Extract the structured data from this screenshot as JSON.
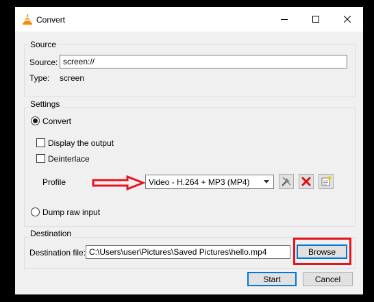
{
  "window": {
    "title": "Convert"
  },
  "source": {
    "group_title": "Source",
    "source_label": "Source:",
    "source_value": "screen://",
    "type_label": "Type:",
    "type_value": "screen"
  },
  "settings": {
    "group_title": "Settings",
    "convert_label": "Convert",
    "display_output_label": "Display the output",
    "deinterlace_label": "Deinterlace",
    "profile_label": "Profile",
    "profile_selected": "Video - H.264 + MP3 (MP4)",
    "dump_raw_label": "Dump raw input"
  },
  "destination": {
    "group_title": "Destination",
    "file_label": "Destination file:",
    "file_value": "C:\\Users\\user\\Pictures\\Saved Pictures\\hello.mp4",
    "browse_label": "Browse"
  },
  "footer": {
    "start_label": "Start",
    "cancel_label": "Cancel"
  },
  "colors": {
    "annotation_red": "#e8131f",
    "focus_blue": "#0078d7"
  },
  "icons": [
    "vlc-cone-icon",
    "minimize-icon",
    "maximize-icon",
    "close-icon",
    "chevron-down-icon",
    "edit-profile-icon",
    "delete-profile-icon",
    "new-profile-icon",
    "red-arrow-icon"
  ]
}
